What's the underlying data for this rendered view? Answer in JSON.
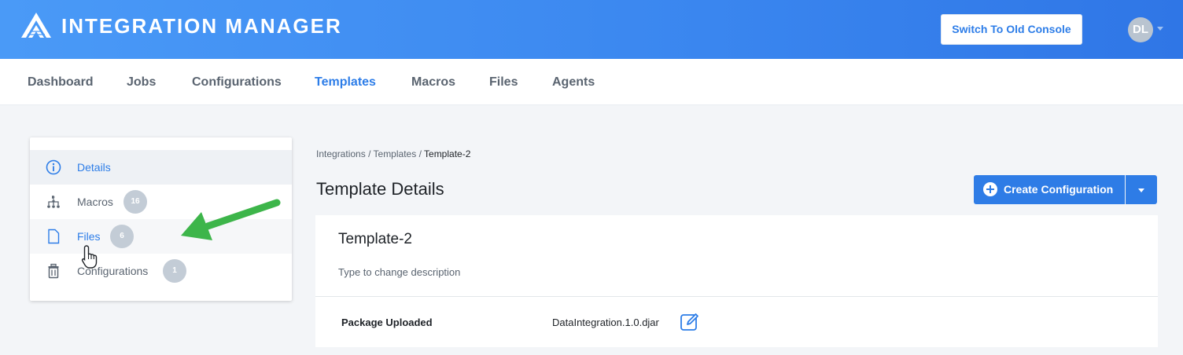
{
  "header": {
    "app_title": "INTEGRATION MANAGER",
    "switch_label": "Switch To Old Console",
    "user_initials": "DL"
  },
  "nav": {
    "items": [
      "Dashboard",
      "Jobs",
      "Configurations",
      "Templates",
      "Macros",
      "Files",
      "Agents"
    ],
    "active": "Templates"
  },
  "sidebar": {
    "items": [
      {
        "label": "Details",
        "icon": "info-circle-icon"
      },
      {
        "label": "Macros",
        "icon": "macro-tree-icon",
        "count": "16"
      },
      {
        "label": "Files",
        "icon": "file-icon",
        "count": "6"
      },
      {
        "label": "Configurations",
        "icon": "trash-can-icon",
        "count": "1"
      }
    ],
    "selected": "Details"
  },
  "breadcrumb": {
    "items": [
      "Integrations",
      "Templates",
      "Template-2"
    ]
  },
  "page": {
    "title": "Template Details",
    "create_label": "Create Configuration"
  },
  "card": {
    "name": "Template-2",
    "description": "Type to change description",
    "package_label": "Package Uploaded",
    "package_file": "DataIntegration.1.0.djar"
  },
  "colors": {
    "accent": "#2e7ce6",
    "header_start": "#4a9af7",
    "header_end": "#2f76e6",
    "arrow": "#3db54a"
  }
}
